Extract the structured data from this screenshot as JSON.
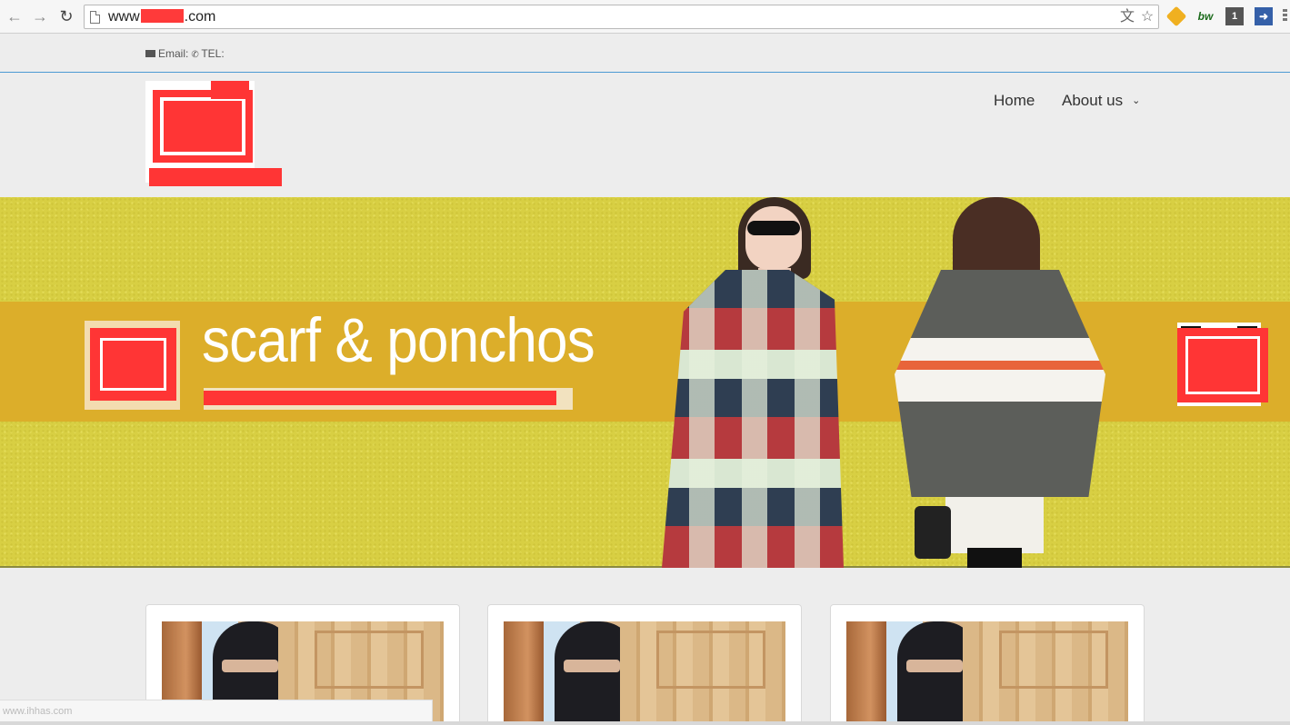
{
  "browser": {
    "url_prefix": "www",
    "url_suffix": "com",
    "back_icon": "back-arrow-icon",
    "forward_icon": "forward-arrow-icon",
    "reload_icon": "reload-icon",
    "extensions": [
      "translate-icon",
      "star-icon",
      "extension-icon",
      "bw-extension-icon",
      "one-extension-icon",
      "arrow-extension-icon",
      "menu-icon"
    ],
    "bw_label": "bw",
    "one_label": "1"
  },
  "topbar": {
    "email_label": "Email:",
    "tel_label": "TEL:"
  },
  "nav": {
    "home": "Home",
    "about": "About us"
  },
  "banner": {
    "headline": "scarf & ponchos"
  },
  "status": {
    "url": "www.ihhas.com"
  },
  "colors": {
    "banner_yellow": "#d8cf43",
    "banner_band": "#dcae2a",
    "redaction": "#ff3535",
    "topbar_line": "#4b9ad3"
  }
}
